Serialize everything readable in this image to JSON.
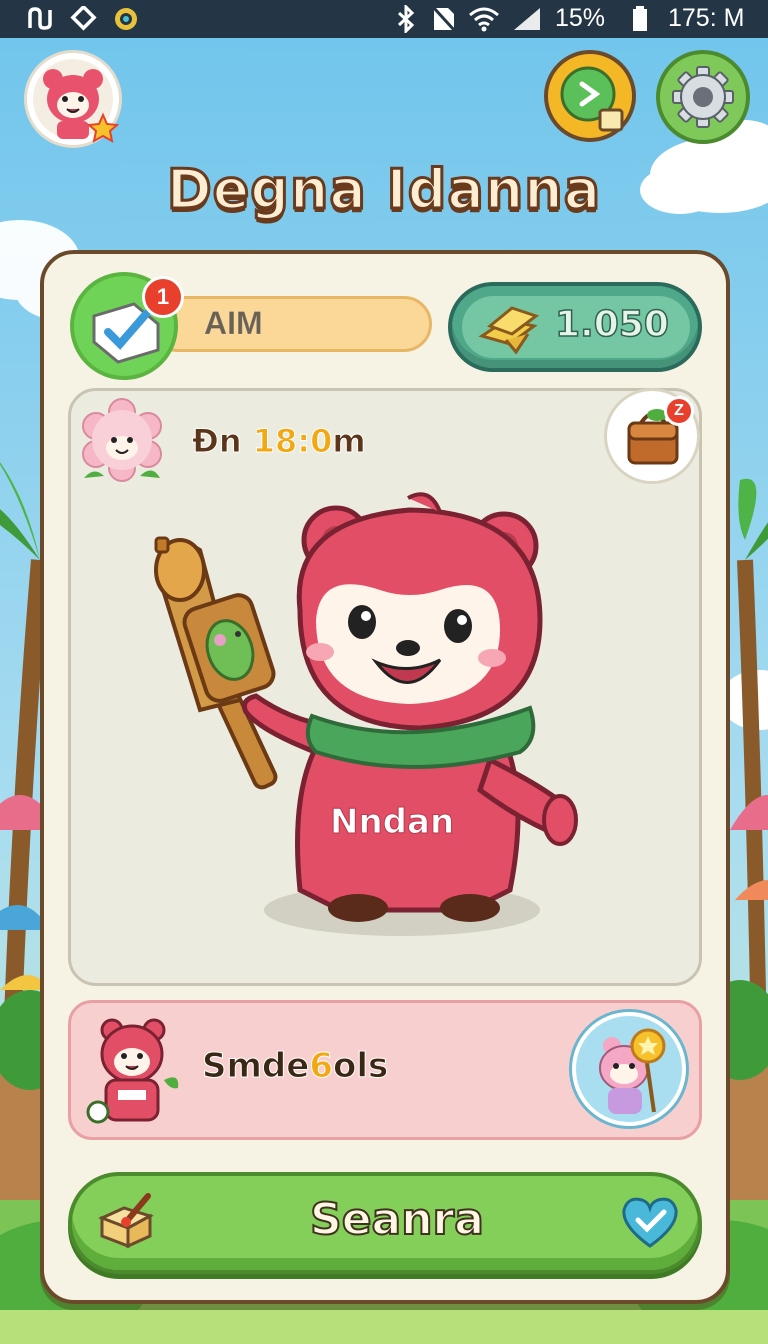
{
  "status_bar": {
    "battery": "15%",
    "time": "175: M",
    "icons": [
      "usb-icon",
      "diamond-icon",
      "circle-app-icon",
      "bluetooth-icon",
      "no-sim-icon",
      "wifi-icon",
      "signal-icon",
      "battery-icon"
    ]
  },
  "header": {
    "title": "Degna Idanna",
    "avatar_icon": "bear-avatar-icon",
    "play_icon": "play-calendar-icon",
    "settings_icon": "gear-icon"
  },
  "card": {
    "aim_label": "AIM",
    "aim_badge": "1",
    "coins": "1.050",
    "timer_prefix": "Ðn ",
    "timer_highlight": "18:0",
    "timer_suffix": "m",
    "bag_badge": "Z",
    "shirt_label": "Nndan",
    "quest_prefix": "Smde",
    "quest_highlight": "6",
    "quest_suffix": "ols",
    "action_label": "Seanra"
  },
  "colors": {
    "sky": "#8fd0ee",
    "card": "#f7f3e4",
    "bear": "#e8526c",
    "coin_pill": "#4fa889",
    "action": "#84cf5a",
    "badge": "#e8402c"
  }
}
